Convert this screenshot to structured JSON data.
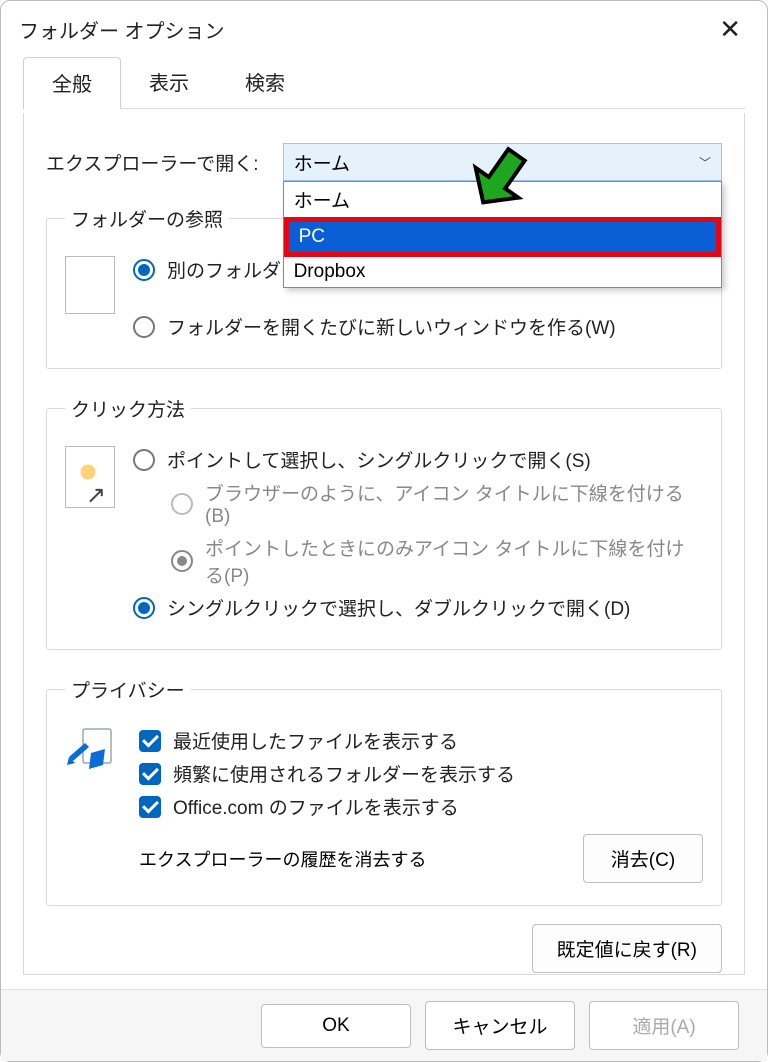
{
  "title": "フォルダー オプション",
  "tabs": {
    "general": "全般",
    "view": "表示",
    "search": "検索"
  },
  "explorer_open": {
    "label": "エクスプローラーで開く:",
    "selected": "ホーム",
    "options": [
      "ホーム",
      "PC",
      "Dropbox"
    ]
  },
  "folder_browse": {
    "legend": "フォルダーの参照",
    "opt1": "別のフォルダー",
    "opt2": "フォルダーを開くたびに新しいウィンドウを作る(W)"
  },
  "click_method": {
    "legend": "クリック方法",
    "opt1": "ポイントして選択し、シングルクリックで開く(S)",
    "sub1": "ブラウザーのように、アイコン タイトルに下線を付ける(B)",
    "sub2": "ポイントしたときにのみアイコン タイトルに下線を付ける(P)",
    "opt2": "シングルクリックで選択し、ダブルクリックで開く(D)"
  },
  "privacy": {
    "legend": "プライバシー",
    "chk1": "最近使用したファイルを表示する",
    "chk2": "頻繁に使用されるフォルダーを表示する",
    "chk3": "Office.com のファイルを表示する",
    "clear_label": "エクスプローラーの履歴を消去する",
    "clear_btn": "消去(C)"
  },
  "restore_btn": "既定値に戻す(R)",
  "footer": {
    "ok": "OK",
    "cancel": "キャンセル",
    "apply": "適用(A)"
  }
}
